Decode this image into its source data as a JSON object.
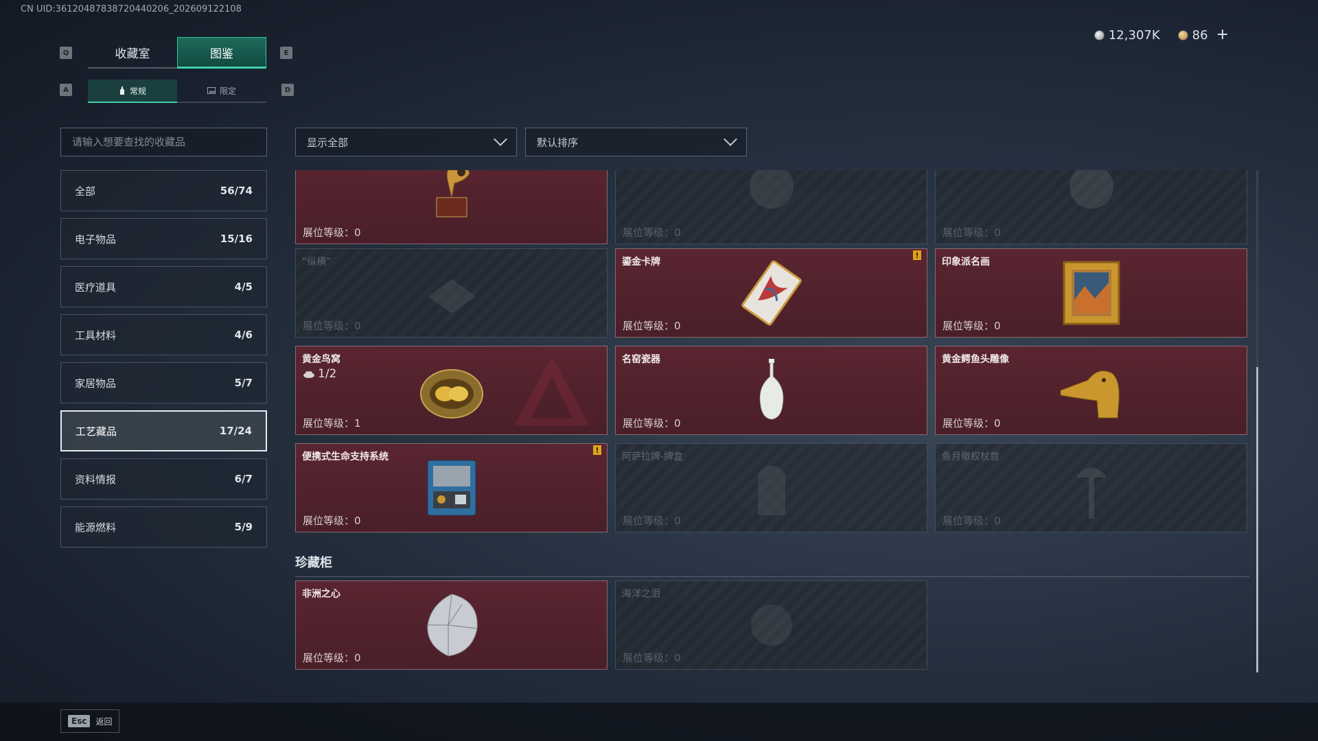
{
  "uid": "CN UID:36120487838720440206_202609122108",
  "currency": {
    "silver": "12,307K",
    "gold": "86",
    "add_label": "+"
  },
  "keys": {
    "prev_tab": "Q",
    "next_tab": "E",
    "prev_sub": "A",
    "next_sub": "D",
    "esc": "Esc"
  },
  "tabs": [
    {
      "label": "收藏室"
    },
    {
      "label": "图鉴"
    }
  ],
  "subtabs": [
    {
      "label": "常规"
    },
    {
      "label": "限定"
    }
  ],
  "search": {
    "placeholder": "请输入想要查找的收藏品"
  },
  "filters": {
    "display": "显示全部",
    "sort": "默认排序"
  },
  "categories": [
    {
      "label": "全部",
      "count": "56/74"
    },
    {
      "label": "电子物品",
      "count": "15/16"
    },
    {
      "label": "医疗道具",
      "count": "4/5"
    },
    {
      "label": "工具材料",
      "count": "4/6"
    },
    {
      "label": "家居物品",
      "count": "5/7"
    },
    {
      "label": "工艺藏品",
      "count": "17/24"
    },
    {
      "label": "资料情报",
      "count": "6/7"
    },
    {
      "label": "能源燃料",
      "count": "5/9"
    }
  ],
  "level_label": "展位等级：",
  "cards": [
    {
      "name": "",
      "level": "0",
      "locked": false,
      "icon": "gramophone-icon"
    },
    {
      "name": "",
      "level": "0",
      "locked": true,
      "icon": "globe-icon"
    },
    {
      "name": "",
      "level": "0",
      "locked": true,
      "icon": "globe-icon"
    },
    {
      "name": "“纵横”",
      "level": "0",
      "locked": true,
      "icon": "chessboard-icon"
    },
    {
      "name": "鎏金卡牌",
      "level": "0",
      "locked": false,
      "icon": "card-icon",
      "warn": true
    },
    {
      "name": "印象派名画",
      "level": "0",
      "locked": false,
      "icon": "painting-icon"
    },
    {
      "name": "黄金鸟窝",
      "level": "1",
      "locked": false,
      "icon": "nest-icon",
      "qty": "1/2"
    },
    {
      "name": "名窑瓷器",
      "level": "0",
      "locked": false,
      "icon": "vase-icon"
    },
    {
      "name": "黄金鳄鱼头雕像",
      "level": "0",
      "locked": false,
      "icon": "crocodile-icon"
    },
    {
      "name": "便携式生命支持系统",
      "level": "0",
      "locked": false,
      "icon": "machine-icon",
      "warn": true
    },
    {
      "name": "阿萨拉牌-牌盒",
      "level": "0",
      "locked": true,
      "icon": "cardbox-icon"
    },
    {
      "name": "鱼月徽权杖首",
      "level": "0",
      "locked": true,
      "icon": "scepter-icon"
    }
  ],
  "section": {
    "title": "珍藏柜",
    "cards": [
      {
        "name": "非洲之心",
        "level": "0",
        "locked": false,
        "icon": "diamond-icon"
      },
      {
        "name": "海洋之泪",
        "level": "0",
        "locked": true,
        "icon": "gem-icon"
      }
    ]
  },
  "footer": {
    "back_label": "返回"
  },
  "colors": {
    "accent": "#3fd1a6",
    "card_bg": "#4f2129",
    "locked_bg": "#2a3038",
    "warn": "#e0a21c"
  }
}
